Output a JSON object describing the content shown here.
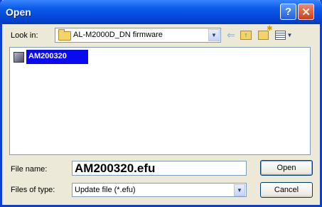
{
  "window": {
    "title": "Open",
    "help_glyph": "?",
    "close_glyph": "✕"
  },
  "toolbar": {
    "look_in_label": "Look in:",
    "look_in_value": "AL-M2000D_DN firmware",
    "back_icon": "back-arrow-icon",
    "up_icon": "up-one-level-icon",
    "new_folder_icon": "new-folder-icon",
    "views_icon": "views-menu-icon"
  },
  "file_list": {
    "items": [
      {
        "name": "AM200320",
        "icon": "file-icon",
        "selected": true
      }
    ]
  },
  "form": {
    "file_name_label": "File name:",
    "file_name_value": "AM200320.efu",
    "files_of_type_label": "Files of type:",
    "files_of_type_value": "Update file (*.efu)"
  },
  "buttons": {
    "open": "Open",
    "cancel": "Cancel"
  },
  "colors": {
    "titlebar": "#0546d6",
    "selection": "#0a0af0",
    "dialog_bg": "#ece9d8"
  }
}
